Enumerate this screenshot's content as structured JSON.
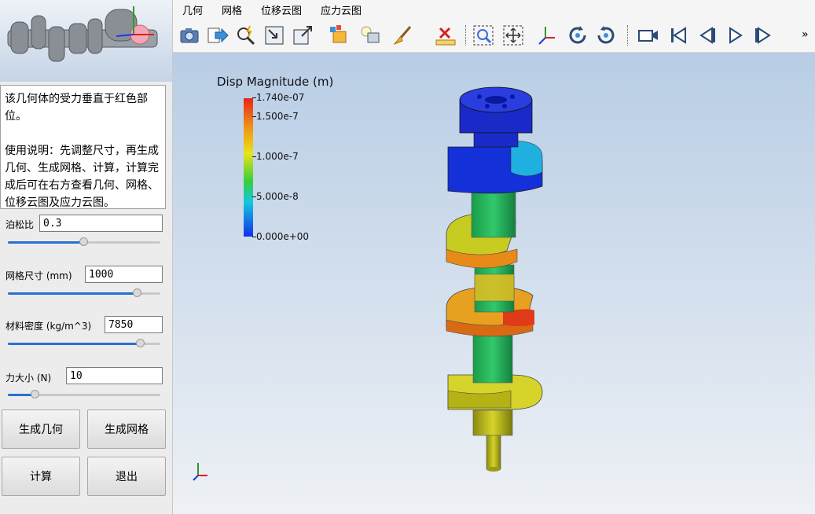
{
  "left_panel": {
    "description": "该几何体的受力垂直于红色部位。",
    "usage": "使用说明：先调整尺寸，再生成几何、生成网格、计算，计算完成后可在右方查看几何、网格、位移云图及应力云图。",
    "fields": [
      {
        "label": "泊松比",
        "value": "0.3",
        "slider_level": 0.5
      },
      {
        "label": "网格尺寸 (mm)",
        "value": "1000",
        "slider_level": 0.85
      },
      {
        "label": "材料密度 (kg/m^3)",
        "value": "7850",
        "slider_level": 0.87
      },
      {
        "label": "力大小 (N)",
        "value": "10",
        "slider_level": 0.18
      }
    ],
    "buttons": {
      "gen_geometry": "生成几何",
      "gen_mesh": "生成网格",
      "compute": "计算",
      "exit": "退出"
    }
  },
  "menu": {
    "items": [
      "几何",
      "网格",
      "位移云图",
      "应力云图"
    ]
  },
  "toolbar": {
    "overflow": "»",
    "tools": [
      "camera-icon",
      "export-icon",
      "zoom-pick-icon",
      "fit-view-icon",
      "maximize-icon",
      "box-color-icon",
      "light-icon",
      "clear-icon",
      "ruler-icon",
      "zoom-box-icon",
      "pan-icon",
      "axes-icon",
      "rotate-cw-icon",
      "rotate-ccw-icon",
      "video-icon",
      "first-frame-icon",
      "prev-frame-icon",
      "play-icon",
      "next-frame-icon"
    ]
  },
  "viewport": {
    "colorbar_title": "Disp Magnitude (m)",
    "ticks": [
      "1.740e-07",
      "1.500e-7",
      "1.000e-7",
      "5.000e-8",
      "0.000e+00"
    ]
  },
  "colors": {
    "accent": "#2a6fd1",
    "max": "#e8261a",
    "min": "#1230e8"
  }
}
